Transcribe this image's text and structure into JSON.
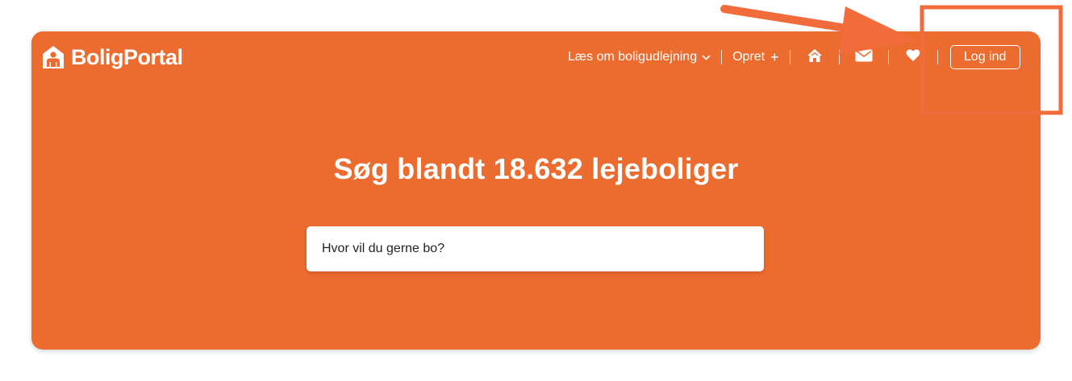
{
  "brand": {
    "name": "BoligPortal",
    "color": "#ec6b2e"
  },
  "nav": {
    "read_about_label": "Læs om boligudlejning",
    "create_label": "Opret",
    "icons": [
      "home-icon",
      "mail-icon",
      "heart-icon"
    ],
    "login_label": "Log ind"
  },
  "hero": {
    "headline": "Søg blandt 18.632 lejeboliger"
  },
  "search": {
    "placeholder": "Hvor vil du gerne bo?"
  },
  "annotation": {
    "color": "#f26b3a",
    "elements": [
      "highlight-box",
      "pointer-arrow"
    ]
  }
}
